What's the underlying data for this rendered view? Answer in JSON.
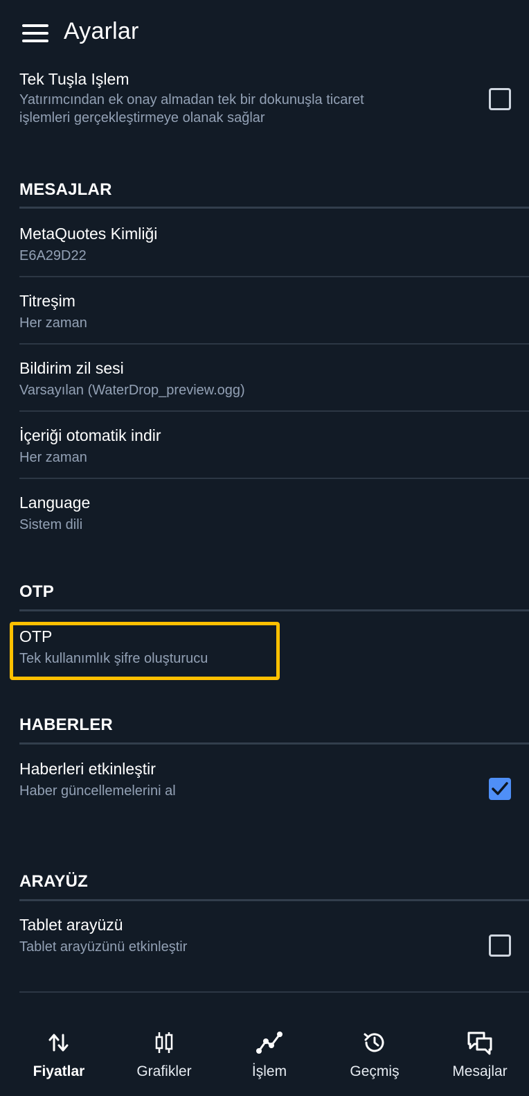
{
  "header": {
    "title": "Ayarlar",
    "menu_icon": "hamburger-menu-icon"
  },
  "one_click": {
    "title": "Tek Tuşla Işlem",
    "subtitle_line1": "Yatırımcından ek onay almadan tek bir dokunuşla ticaret",
    "subtitle_line2": "işlemleri gerçekleştirmeye olanak sağlar",
    "checked": false
  },
  "messages_section": {
    "heading": "MESAJLAR",
    "items": [
      {
        "title": "MetaQuotes Kimliği",
        "value": "E6A29D22"
      },
      {
        "title": "Titreşim",
        "value": "Her zaman"
      },
      {
        "title": "Bildirim zil sesi",
        "value": "Varsayılan (WaterDrop_preview.ogg)"
      },
      {
        "title": "İçeriği otomatik indir",
        "value": "Her zaman"
      },
      {
        "title": "Language",
        "value": "Sistem dili"
      }
    ]
  },
  "otp_section": {
    "heading": "OTP",
    "item": {
      "title": "OTP",
      "value": "Tek kullanımlık şifre oluşturucu"
    }
  },
  "news_section": {
    "heading": "HABERLER",
    "item": {
      "title": "Haberleri etkinleştir",
      "value": "Haber güncellemelerini al",
      "checked": true
    }
  },
  "interface_section": {
    "heading": "ARAYÜZ",
    "item": {
      "title": "Tablet arayüzü",
      "value": "Tablet arayüzünü etkinleştir",
      "checked": false
    }
  },
  "colors": {
    "background": "#121b26",
    "accent": "#4f8ff7",
    "highlight": "#ffc000",
    "subtitle": "#93a1b5"
  },
  "bottom_nav": [
    {
      "label": "Fiyatlar",
      "icon": "quotes-arrows-icon",
      "active": true
    },
    {
      "label": "Grafikler",
      "icon": "candlestick-chart-icon",
      "active": false
    },
    {
      "label": "İşlem",
      "icon": "trade-line-icon",
      "active": false
    },
    {
      "label": "Geçmiş",
      "icon": "history-clock-icon",
      "active": false
    },
    {
      "label": "Mesajlar",
      "icon": "chat-bubbles-icon",
      "active": false
    }
  ]
}
